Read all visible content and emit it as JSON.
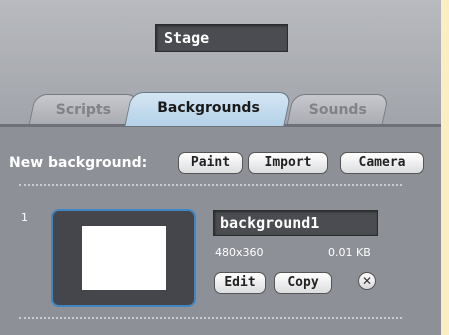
{
  "sprite": {
    "name": "Stage"
  },
  "tabs": [
    {
      "label": "Scripts",
      "active": false
    },
    {
      "label": "Backgrounds",
      "active": true
    },
    {
      "label": "Sounds",
      "active": false
    }
  ],
  "new_background": {
    "label": "New background:",
    "buttons": {
      "paint": "Paint",
      "import": "Import",
      "camera": "Camera"
    }
  },
  "backgrounds": [
    {
      "index": "1",
      "name": "background1",
      "dimensions": "480x360",
      "size": "0.01 KB",
      "edit_label": "Edit",
      "copy_label": "Copy",
      "delete_glyph": "✕",
      "delete_icon": "close-icon"
    }
  ],
  "colors": {
    "panel": "#8d9097",
    "active_tab": "#c2dcef",
    "selection_border": "#3f86c2",
    "outer_background": "#fbeec0"
  }
}
